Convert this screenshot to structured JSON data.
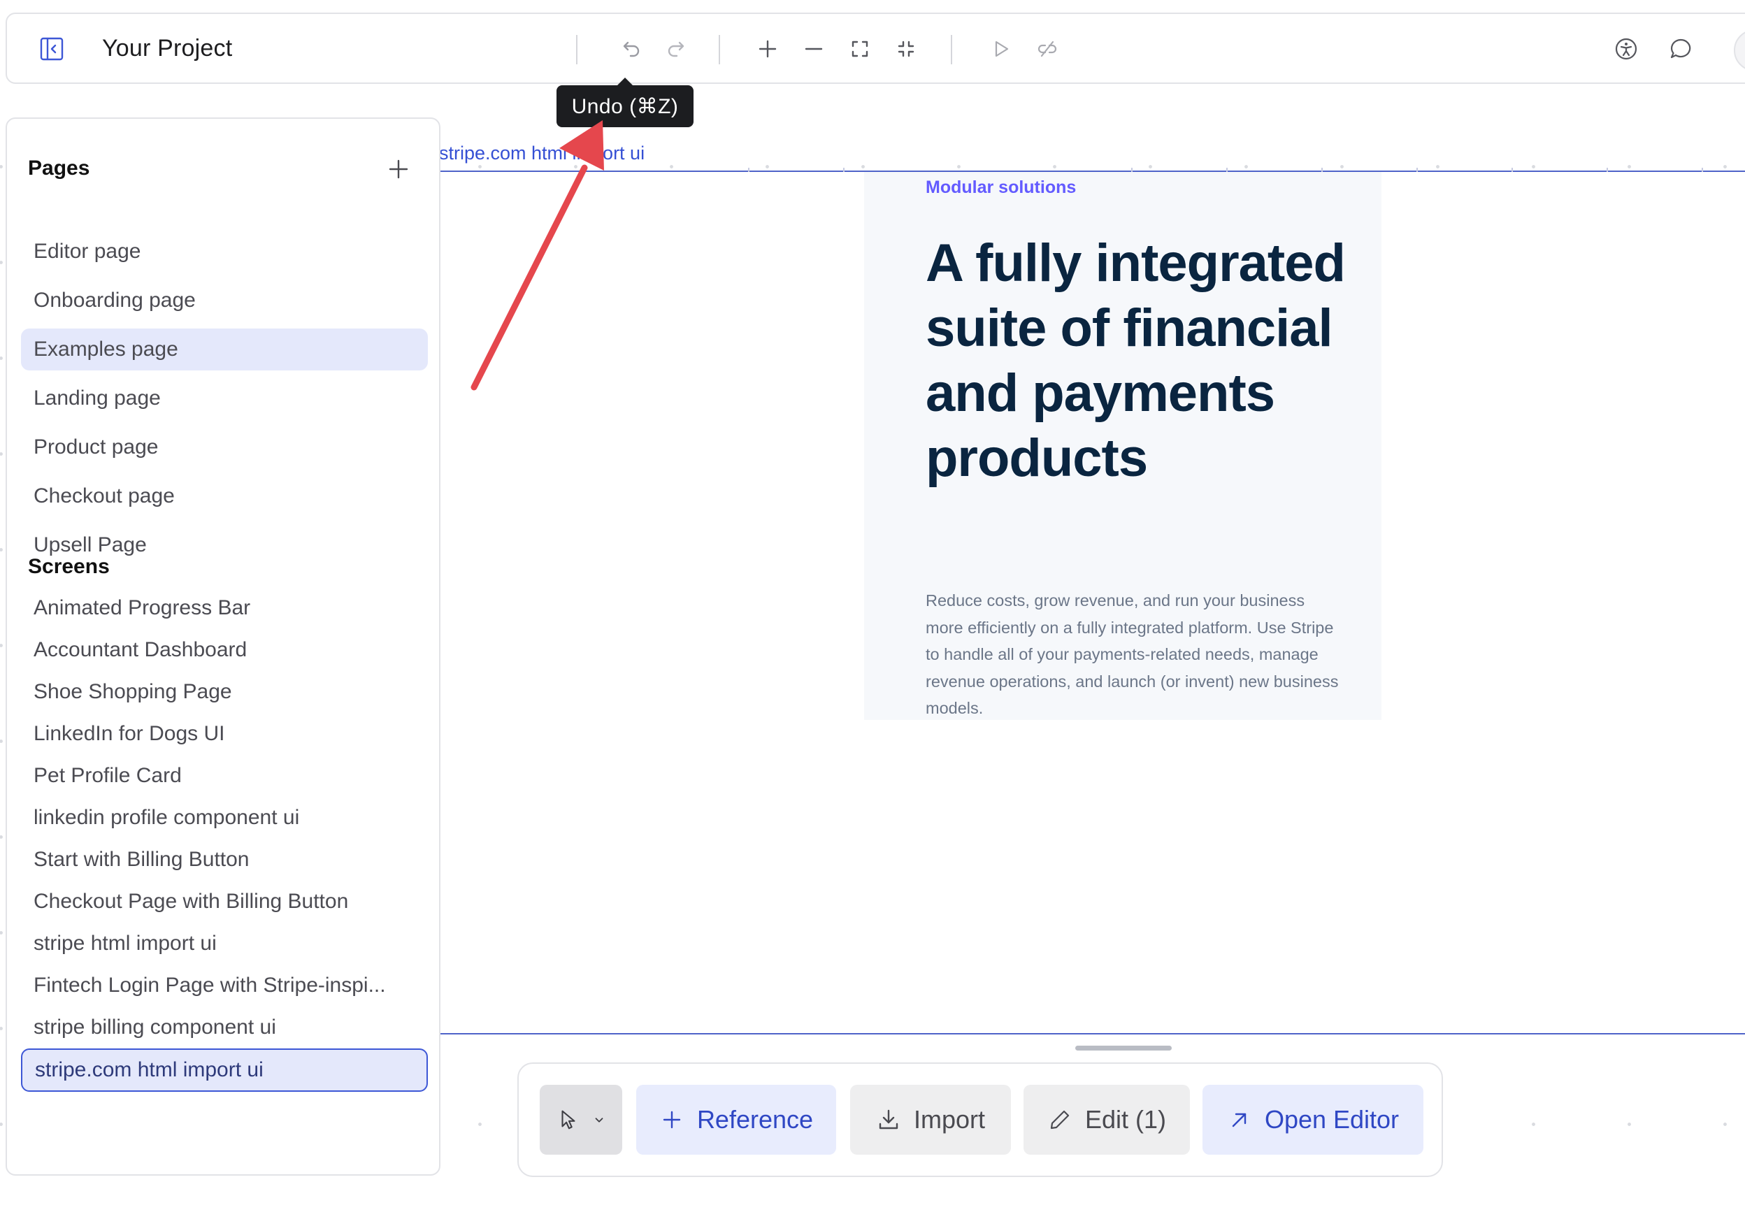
{
  "topbar": {
    "project_title": "Your Project"
  },
  "tooltip": {
    "text": "Undo (⌘Z)"
  },
  "pages_panel": {
    "title": "Pages",
    "pages": [
      "Editor page",
      "Onboarding page",
      "Examples page",
      "Landing page",
      "Product page",
      "Checkout page",
      "Upsell Page"
    ],
    "screens_title": "Screens",
    "screens": [
      "Animated Progress Bar",
      "Accountant Dashboard",
      "Shoe Shopping Page",
      "LinkedIn for Dogs UI",
      "Pet Profile Card",
      "linkedin profile component ui",
      "Start with Billing Button",
      "Checkout Page with Billing Button",
      "stripe html import ui",
      "Fintech Login Page with Stripe-inspi...",
      "stripe billing component ui",
      "stripe.com html import ui"
    ]
  },
  "canvas": {
    "frame_label": "stripe.com html import ui",
    "eyebrow": "Modular solutions",
    "headline": "A fully integrated suite of financial and payments products",
    "body": "Reduce costs, grow revenue, and run your business more efficiently on a fully integrated platform. Use Stripe to handle all of your payments-related needs, manage revenue operations, and launch (or invent) new business models."
  },
  "bottom_toolbar": {
    "reference_label": "Reference",
    "import_label": "Import",
    "edit_label": "Edit (1)",
    "open_editor_label": "Open Editor"
  },
  "colors": {
    "accent": "#3550d4",
    "annotation_arrow": "#e5474d",
    "headline": "#0a2540",
    "eyebrow": "#635bff"
  }
}
